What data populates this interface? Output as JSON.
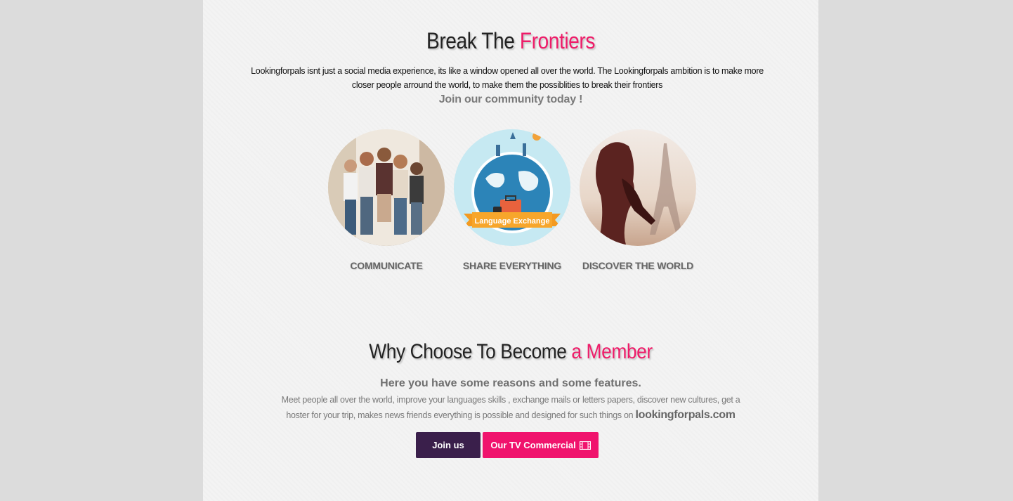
{
  "section1": {
    "title_plain": "Break The",
    "title_accent": "Frontiers",
    "intro": "Lookingforpals isnt just a social media experience, its like a window opened all over the world. The Lookingforpals ambition is to make more closer people arround the world, to make them the possiblities to break their frontiers",
    "join_line": "Join our community today !",
    "features": [
      {
        "label": "COMMUNICATE",
        "image": "friends-group-photo"
      },
      {
        "label": "SHARE EVERYTHING",
        "image": "globe-travel-illustration",
        "banner": "Language Exchange"
      },
      {
        "label": "DISCOVER THE WORLD",
        "image": "eiffel-tower-couple-photo"
      }
    ]
  },
  "section2": {
    "title_plain": "Why Choose To Become",
    "title_accent": "a Member",
    "reasons": "Here you have some reasons and some features.",
    "features_text": "Meet people all over the world, improve your languages skills , exchange mails or letters papers, discover new cultures, get a hoster for your trip, makes news friends everything is possible and designed for such things on",
    "domain": "lookingforpals.com"
  },
  "buttons": {
    "join": "Join us",
    "tv": "Our TV Commercial",
    "tv_icon": "film-icon"
  },
  "colors": {
    "accent": "#ee1c69",
    "join_button": "#3a1f4b",
    "tv_button": "#f0136d",
    "page_bg": "#dcdcdc"
  }
}
